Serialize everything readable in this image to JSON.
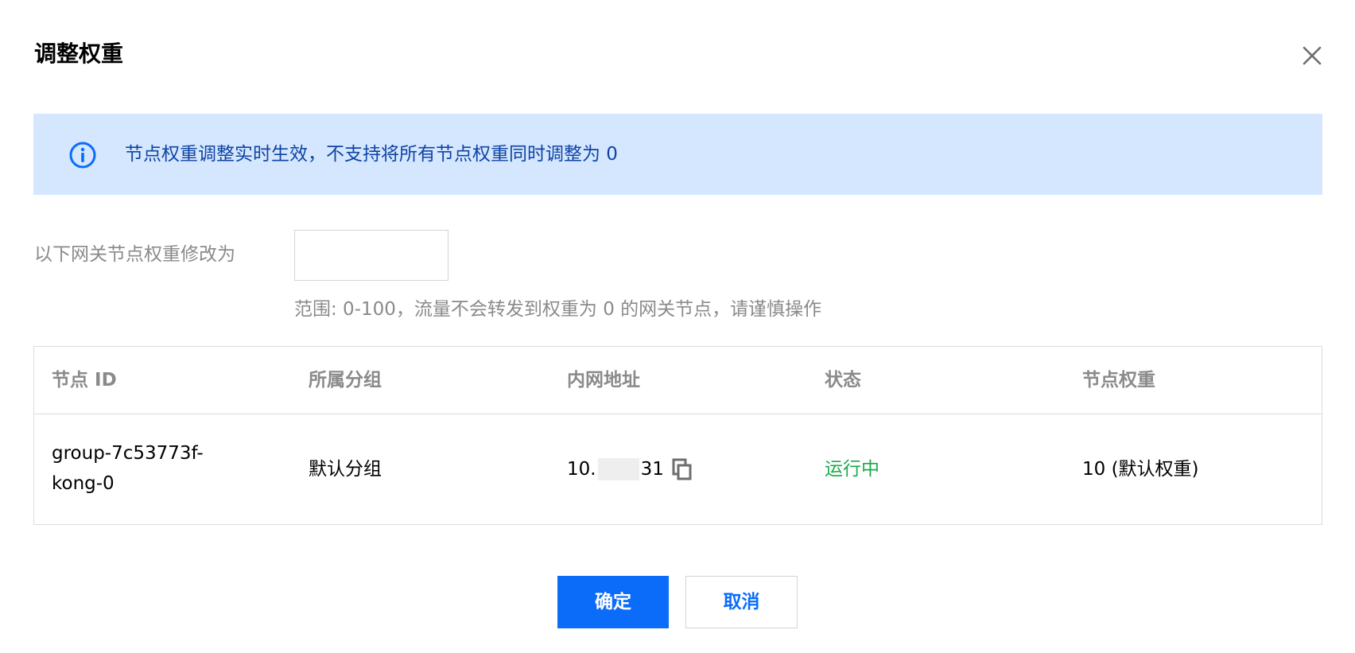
{
  "dialog": {
    "title": "调整权重"
  },
  "notice": {
    "text": "节点权重调整实时生效，不支持将所有节点权重同时调整为 0",
    "icon": "info-circle-icon",
    "color": "#0f44a4",
    "background": "#d5e7ff"
  },
  "form": {
    "label": "以下网关节点权重修改为",
    "input_value": "",
    "hint": "范围: 0-100，流量不会转发到权重为 0 的网关节点，请谨慎操作"
  },
  "table": {
    "columns": [
      "节点 ID",
      "所属分组",
      "内网地址",
      "状态",
      "节点权重"
    ],
    "rows": [
      {
        "node_id_line1": "group-7c53773f-",
        "node_id_line2": "kong-0",
        "group": "默认分组",
        "ip_prefix": "10.",
        "ip_suffix": "31",
        "status": "运行中",
        "weight": "10 (默认权重)"
      }
    ]
  },
  "buttons": {
    "confirm": "确定",
    "cancel": "取消"
  },
  "colors": {
    "primary": "#0b6cfa",
    "status_running": "#1aab4b",
    "muted_text": "#8a8a8a"
  }
}
